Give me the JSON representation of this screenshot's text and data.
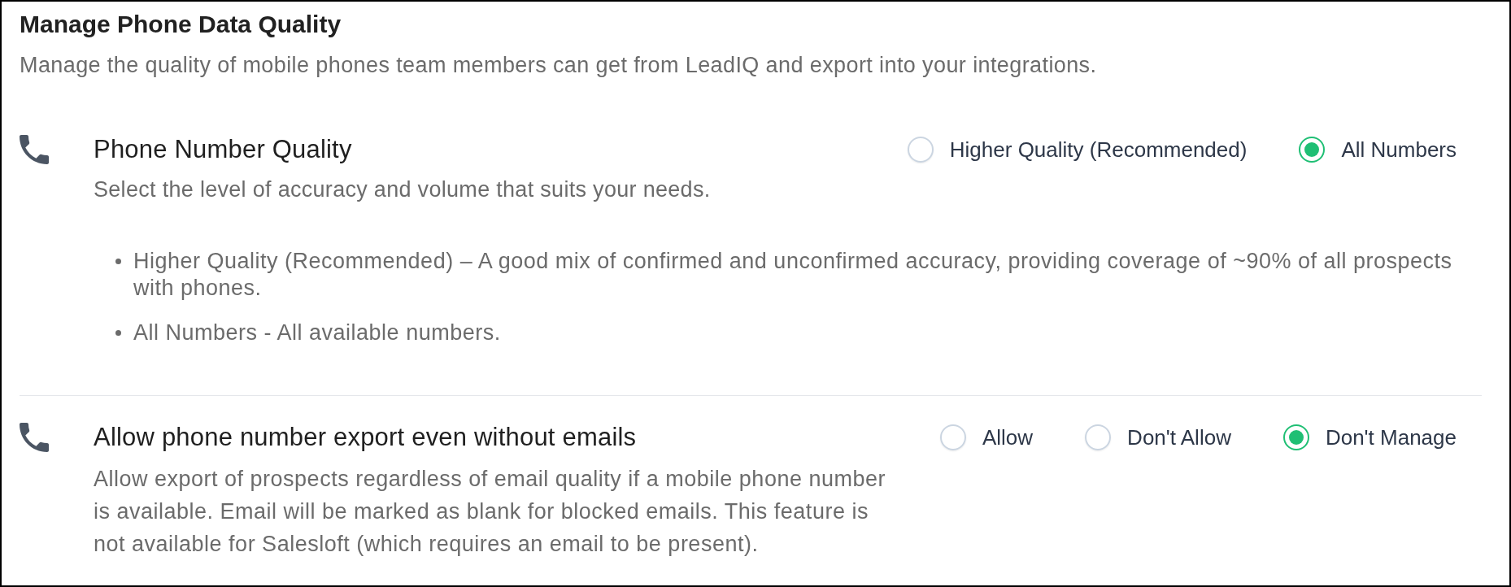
{
  "header": {
    "title": "Manage Phone Data Quality",
    "subtitle": "Manage the quality of mobile phones team members can get from LeadIQ and export into your integrations."
  },
  "settings": [
    {
      "title": "Phone Number Quality",
      "description": "Select the level of accuracy and volume that suits your needs.",
      "options": [
        {
          "label": "Higher Quality (Recommended)",
          "selected": false
        },
        {
          "label": "All Numbers",
          "selected": true
        }
      ],
      "notes": [
        "Higher Quality (Recommended) – A good mix of confirmed and unconfirmed accuracy, providing coverage of ~90% of all prospects with phones.",
        "All Numbers - All available numbers."
      ]
    },
    {
      "title": "Allow phone number export even without emails",
      "description": "Allow export of prospects regardless of email quality if a mobile phone number is available. Email will be marked as blank for blocked emails. This feature is not available for Salesloft (which requires an email to be present).",
      "options": [
        {
          "label": "Allow",
          "selected": false
        },
        {
          "label": "Don't Allow",
          "selected": false
        },
        {
          "label": "Don't Manage",
          "selected": true
        }
      ]
    }
  ]
}
